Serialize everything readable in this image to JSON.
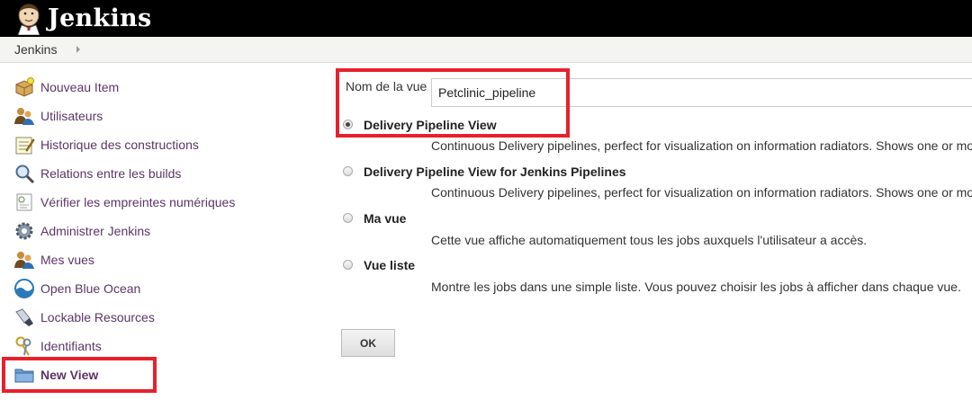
{
  "header": {
    "brand": "Jenkins"
  },
  "breadcrumb": {
    "root": "Jenkins"
  },
  "sidebar": {
    "items": [
      {
        "label": "Nouveau Item",
        "icon": "new-item-package-icon"
      },
      {
        "label": "Utilisateurs",
        "icon": "users-icon"
      },
      {
        "label": "Historique des constructions",
        "icon": "notepad-history-icon"
      },
      {
        "label": "Relations entre les builds",
        "icon": "magnifier-icon"
      },
      {
        "label": "Vérifier les empreintes numériques",
        "icon": "fingerprint-card-icon"
      },
      {
        "label": "Administrer Jenkins",
        "icon": "gear-icon"
      },
      {
        "label": "Mes vues",
        "icon": "users-icon"
      },
      {
        "label": "Open Blue Ocean",
        "icon": "blue-ocean-icon"
      },
      {
        "label": "Lockable Resources",
        "icon": "usb-plug-icon"
      },
      {
        "label": "Identifiants",
        "icon": "keys-icon"
      },
      {
        "label": "New View",
        "icon": "folder-icon"
      }
    ]
  },
  "form": {
    "name_label": "Nom de la vue",
    "name_value": "Petclinic_pipeline",
    "options": [
      {
        "title": "Delivery Pipeline View",
        "description": "Continuous Delivery pipelines, perfect for visualization on information radiators. Shows one or more",
        "checked": true
      },
      {
        "title": "Delivery Pipeline View for Jenkins Pipelines",
        "description": "Continuous Delivery pipelines, perfect for visualization on information radiators. Shows one or more",
        "checked": false
      },
      {
        "title": "Ma vue",
        "description": "Cette vue affiche automatiquement tous les jobs auxquels l'utilisateur a accès.",
        "checked": false
      },
      {
        "title": "Vue liste",
        "description": "Montre les jobs dans une simple liste. Vous pouvez choisir les jobs à afficher dans chaque vue.",
        "checked": false
      }
    ],
    "ok_label": "OK"
  },
  "colors": {
    "highlight": "#e8202c",
    "link": "#5c3566",
    "header_bg": "#000000"
  }
}
